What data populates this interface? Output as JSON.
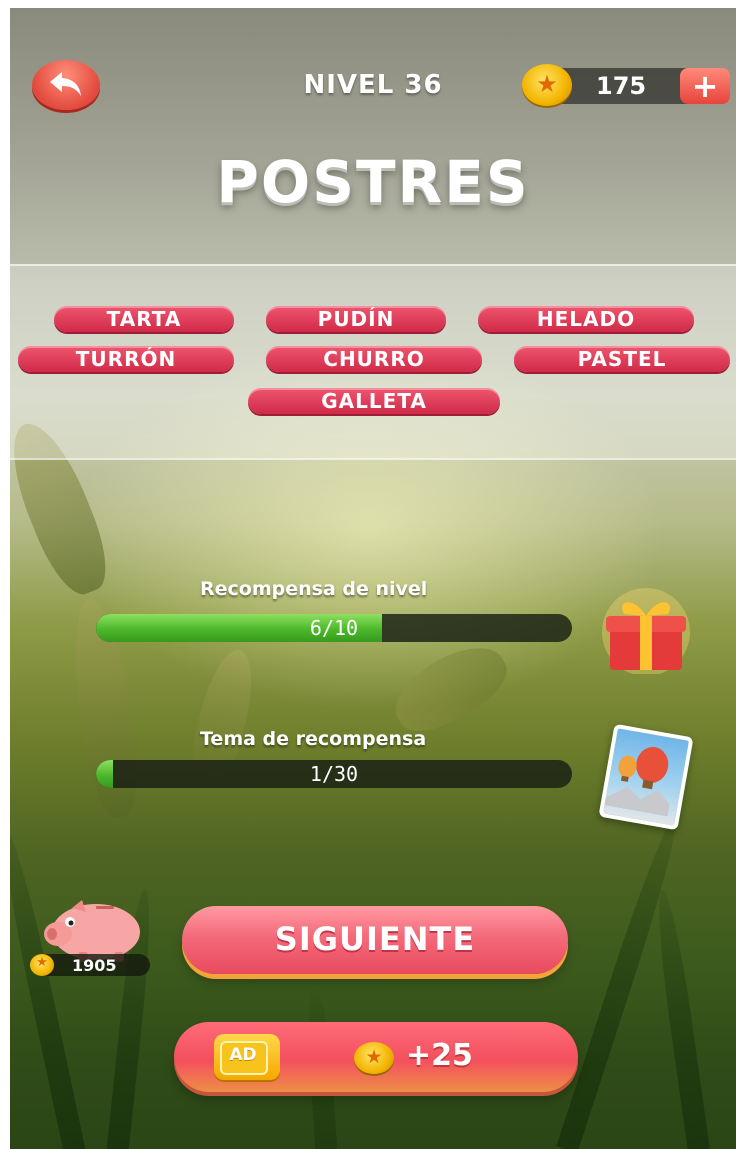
{
  "header": {
    "level_label": "NIVEL 36",
    "coins": "175",
    "plus_label": "+",
    "coin_symbol": "★",
    "back_icon": "back-arrow-icon"
  },
  "title": "POSTRES",
  "words": [
    "TARTA",
    "PUDÍN",
    "HELADO",
    "TURRÓN",
    "CHURRO",
    "PASTEL",
    "GALLETA"
  ],
  "rewards": {
    "level": {
      "label": "Recompensa de nivel",
      "progress_text": "6/10",
      "current": 6,
      "total": 10,
      "icon": "gift-icon"
    },
    "theme": {
      "label": "Tema de recompensa",
      "progress_text": "1/30",
      "current": 1,
      "total": 30,
      "icon": "photo-card-icon"
    }
  },
  "piggy_bank": {
    "coins": "1905",
    "icon": "piggy-bank-icon"
  },
  "buttons": {
    "next_label": "SIGUIENTE",
    "ad_label": "AD",
    "ad_reward": "+25"
  },
  "colors": {
    "word_pill": "#dd3d59",
    "progress_green": "#4cb82a",
    "coin_gold": "#f3b400",
    "button_pink": "#f46a7a"
  }
}
